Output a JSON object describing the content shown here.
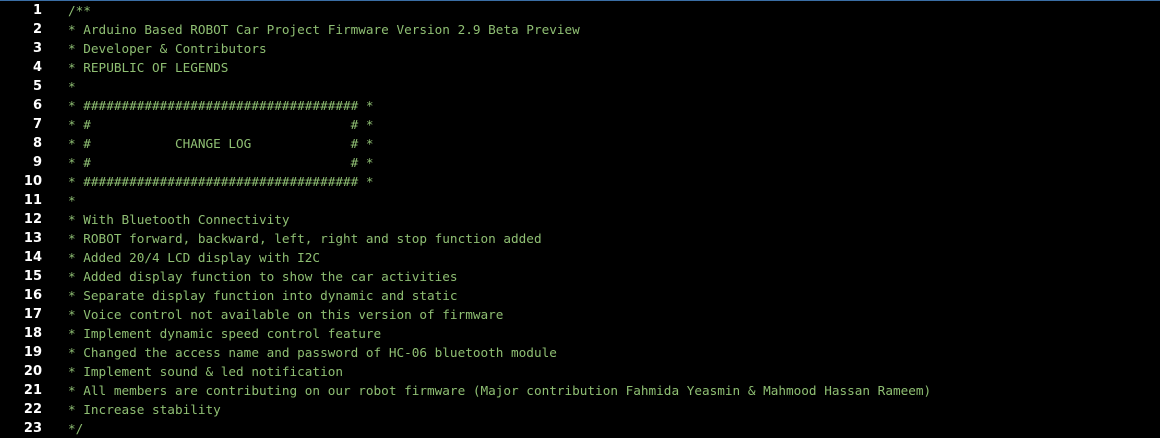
{
  "editor": {
    "lines": [
      {
        "number": "1",
        "text": "/**"
      },
      {
        "number": "2",
        "text": "* Arduino Based ROBOT Car Project Firmware Version 2.9 Beta Preview"
      },
      {
        "number": "3",
        "text": "* Developer & Contributors"
      },
      {
        "number": "4",
        "text": "* REPUBLIC OF LEGENDS"
      },
      {
        "number": "5",
        "text": "*"
      },
      {
        "number": "6",
        "text": "* #################################### *"
      },
      {
        "number": "7",
        "text": "* #                                  # *"
      },
      {
        "number": "8",
        "text": "* #           CHANGE LOG             # *"
      },
      {
        "number": "9",
        "text": "* #                                  # *"
      },
      {
        "number": "10",
        "text": "* #################################### *"
      },
      {
        "number": "11",
        "text": "*"
      },
      {
        "number": "12",
        "text": "* With Bluetooth Connectivity"
      },
      {
        "number": "13",
        "text": "* ROBOT forward, backward, left, right and stop function added"
      },
      {
        "number": "14",
        "text": "* Added 20/4 LCD display with I2C"
      },
      {
        "number": "15",
        "text": "* Added display function to show the car activities"
      },
      {
        "number": "16",
        "text": "* Separate display function into dynamic and static"
      },
      {
        "number": "17",
        "text": "* Voice control not available on this version of firmware"
      },
      {
        "number": "18",
        "text": "* Implement dynamic speed control feature"
      },
      {
        "number": "19",
        "text": "* Changed the access name and password of HC-06 bluetooth module"
      },
      {
        "number": "20",
        "text": "* Implement sound & led notification"
      },
      {
        "number": "21",
        "text": "* All members are contributing on our robot firmware (Major contribution Fahmida Yeasmin & Mahmood Hassan Rameem)"
      },
      {
        "number": "22",
        "text": "* Increase stability"
      },
      {
        "number": "23",
        "text": "*/"
      }
    ]
  },
  "colors": {
    "background": "#000000",
    "line_number": "#ffffff",
    "comment": "#8fbf73",
    "top_border": "#3a6ea5"
  }
}
